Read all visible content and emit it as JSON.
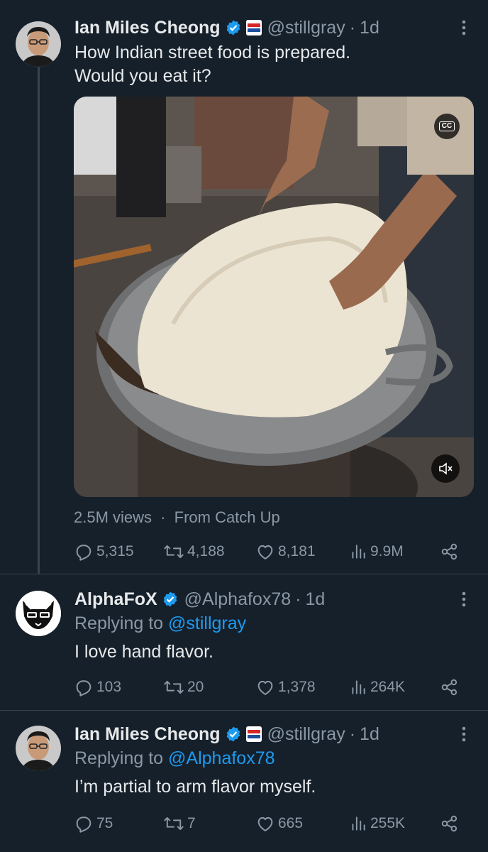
{
  "tweets": [
    {
      "display_name": "Ian Miles Cheong",
      "handle": "@stillgray",
      "separator": "·",
      "time": "1d",
      "text_lines": [
        "How Indian street food is prepared.",
        "Would you eat it?"
      ],
      "media": {
        "cc_label": "CC",
        "description_icon": "video"
      },
      "views_text": "2.5M views",
      "views_separator": "·",
      "source_text": "From Catch Up",
      "stats": {
        "replies": "5,315",
        "reposts": "4,188",
        "likes": "8,181",
        "views": "9.9M"
      }
    },
    {
      "display_name": "AlphaFoX",
      "handle": "@Alphafox78",
      "separator": "·",
      "time": "1d",
      "reply_prefix": "Replying to",
      "reply_mention": "@stillgray",
      "text_lines": [
        "I love hand flavor."
      ],
      "stats": {
        "replies": "103",
        "reposts": "20",
        "likes": "1,378",
        "views": "264K"
      }
    },
    {
      "display_name": "Ian Miles Cheong",
      "handle": "@stillgray",
      "separator": "·",
      "time": "1d",
      "reply_prefix": "Replying to",
      "reply_mention": "@Alphafox78",
      "text_lines": [
        "I’m partial to arm flavor myself."
      ],
      "stats": {
        "replies": "75",
        "reposts": "7",
        "likes": "665",
        "views": "255K"
      }
    }
  ],
  "colors": {
    "background": "#15202b",
    "text_primary": "#e7e9ea",
    "text_secondary": "#8b98a5",
    "link": "#1d9bf0",
    "verified": "#1d9bf0",
    "divider": "#38444d"
  },
  "icons": [
    "reply-icon",
    "repost-icon",
    "like-icon",
    "views-icon",
    "share-icon",
    "more-icon",
    "verified-badge-icon",
    "mute-icon",
    "cc-icon"
  ]
}
